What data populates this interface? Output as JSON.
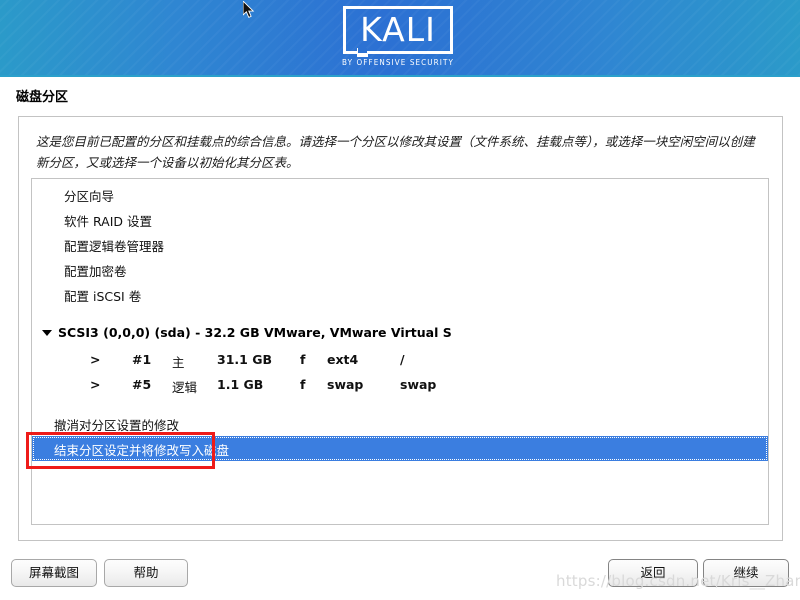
{
  "banner": {
    "logo_word": "KALI",
    "logo_subtitle": "BY OFFENSIVE SECURITY",
    "colors": {
      "edge": "#2b9ac9",
      "center": "#2c70d3",
      "underline": "#2ba0cb"
    }
  },
  "page": {
    "title": "磁盘分区",
    "intro": "这是您目前已配置的分区和挂载点的综合信息。请选择一个分区以修改其设置（文件系统、挂载点等），或选择一块空闲空间以创建新分区，又或选择一个设备以初始化其分区表。"
  },
  "menu_items": [
    {
      "label": "分区向导"
    },
    {
      "label": "软件 RAID 设置"
    },
    {
      "label": "配置逻辑卷管理器"
    },
    {
      "label": "配置加密卷"
    },
    {
      "label": "配置 iSCSI 卷"
    }
  ],
  "disk": {
    "label": "SCSI3 (0,0,0) (sda) - 32.2 GB VMware, VMware Virtual S",
    "expanded": true
  },
  "partitions": [
    {
      "marker": ">",
      "number": "#1",
      "kind": "主",
      "size": "31.1 GB",
      "flag": "f",
      "filesystem": "ext4",
      "mountpoint": "/"
    },
    {
      "marker": ">",
      "number": "#5",
      "kind": "逻辑",
      "size": "1.1 GB",
      "flag": "f",
      "filesystem": "swap",
      "mountpoint": "swap"
    }
  ],
  "actions": [
    {
      "label": "撤消对分区设置的修改",
      "selected": false
    },
    {
      "label": "结束分区设定并将修改写入磁盘",
      "selected": true
    }
  ],
  "annotation": {
    "color": "#ee1b19",
    "shape": "rectangle"
  },
  "footer": {
    "screenshot_label": "屏幕截图",
    "help_label": "帮助",
    "back_label": "返回",
    "continue_label": "继续"
  },
  "watermark": {
    "text": "https://blog.csdn.net/Kris__Zhang"
  }
}
